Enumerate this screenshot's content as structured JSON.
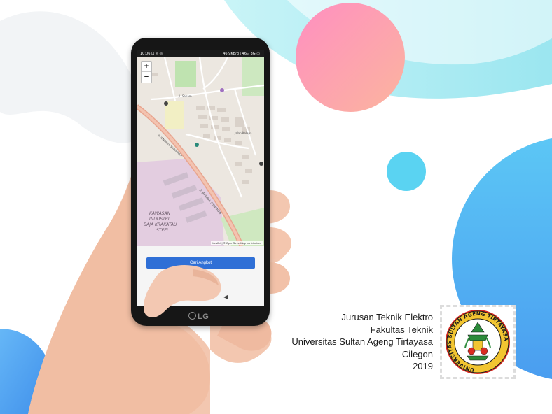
{
  "phone": {
    "status_time": "10:06",
    "status_icons": "⊡ ✉ ◎",
    "status_right": "46,9KB/d ⁞ 46₁₁ 3G ▭",
    "brand": "LG"
  },
  "map": {
    "zoom_in": "+",
    "zoom_out": "−",
    "labels": {
      "area_name_1": "KAWASAN",
      "area_name_2": "INDUSTRI",
      "area_name_3": "BAJA KRAKATAU",
      "area_name_4": "STEEL",
      "road_1": "Jl. JENDRAL SUDIRMAN",
      "road_2": "Jl. JENDRAL SUDIRMAN",
      "road_3": "Jl. Sanam",
      "road_4": "Jalan Kelapa"
    },
    "attribution": "Leaflet | © OpenStreetMap contributors"
  },
  "app": {
    "search_button": "Cari Angkot"
  },
  "info": {
    "line1": "Jurusan Teknik Elektro",
    "line2": "Fakultas Teknik",
    "line3": "Universitas Sultan Ageng Tirtayasa",
    "line4": "Cilegon",
    "line5": "2019"
  },
  "logo": {
    "ring_text": "UNIVERSITAS SULTAN AGENG TIRTAYASA"
  },
  "colors": {
    "pink": "#f98bb0",
    "cyan_light": "#c7f1f6",
    "cyan": "#5fd6f0",
    "blue": "#4aa9ef",
    "button_blue": "#2f6fd6"
  }
}
